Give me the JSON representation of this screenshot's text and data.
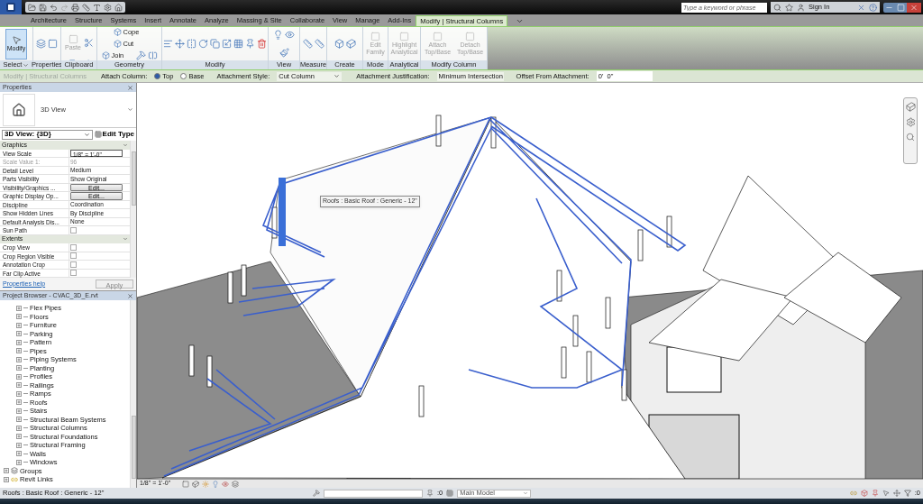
{
  "title_bar": {
    "search": {
      "placeholder": "Type a keyword or phrase"
    },
    "sign_in": "Sign In"
  },
  "ribbon_tabs": [
    {
      "label": "Architecture",
      "selected": false
    },
    {
      "label": "Structure",
      "selected": false
    },
    {
      "label": "Systems",
      "selected": false
    },
    {
      "label": "Insert",
      "selected": false
    },
    {
      "label": "Annotate",
      "selected": false
    },
    {
      "label": "Analyze",
      "selected": false
    },
    {
      "label": "Massing & Site",
      "selected": false
    },
    {
      "label": "Collaborate",
      "selected": false
    },
    {
      "label": "View",
      "selected": false
    },
    {
      "label": "Manage",
      "selected": false
    },
    {
      "label": "Add-Ins",
      "selected": false
    },
    {
      "label": "Modify | Structural Columns",
      "selected": true
    }
  ],
  "ribbon_panels": [
    {
      "title": "Select",
      "dropdown": true,
      "buttons": [
        {
          "label": "Modify",
          "kind": "large",
          "selected": true,
          "disabled": false
        }
      ]
    },
    {
      "title": "Properties"
    },
    {
      "title": "Clipboard",
      "buttons": [
        {
          "label": "Paste",
          "kind": "large",
          "selected": false,
          "disabled": true
        }
      ]
    },
    {
      "title": "Geometry",
      "buttons": [
        {
          "label": "Cope",
          "kind": "small",
          "selected": false,
          "disabled": false
        },
        {
          "label": "Cut",
          "kind": "small",
          "selected": false,
          "disabled": false
        },
        {
          "label": "Join",
          "kind": "small",
          "selected": false,
          "disabled": false
        }
      ]
    },
    {
      "title": "Modify"
    },
    {
      "title": "View"
    },
    {
      "title": "Measure"
    },
    {
      "title": "Create"
    },
    {
      "title": "Mode",
      "buttons": [
        {
          "label": "Edit Family",
          "kind": "large",
          "selected": false,
          "disabled": true
        }
      ]
    },
    {
      "title": "Analytical",
      "buttons": [
        {
          "label": "Highlight Analytical",
          "kind": "large",
          "selected": false,
          "disabled": true
        }
      ]
    },
    {
      "title": "Modify Column",
      "buttons": [
        {
          "label": "Attach Top/Base",
          "kind": "large",
          "selected": false,
          "disabled": true
        },
        {
          "label": "Detach Top/Base",
          "kind": "large",
          "selected": false,
          "disabled": true
        }
      ]
    }
  ],
  "options_bar": {
    "context": "Modify | Structural Columns",
    "attach_label": "Attach Column:",
    "attach_options": [
      {
        "label": "Top",
        "selected": true
      },
      {
        "label": "Base",
        "selected": false
      }
    ],
    "style_label": "Attachment Style:",
    "style_value": "Cut Column",
    "justification_label": "Attachment Justification:",
    "justification_value": "Minimum Intersection",
    "offset_label": "Offset From Attachment:",
    "offset_value": "0'  0\""
  },
  "properties": {
    "title": "Properties",
    "type_name": "3D View",
    "selector": "3D View: {3D}",
    "edit_type": "Edit Type",
    "groups": [
      {
        "name": "Graphics",
        "rows": [
          {
            "name": "View Scale",
            "kind": "input",
            "value": "1/8\" = 1'-0\"",
            "disabled": false
          },
          {
            "name": "Scale Value    1:",
            "kind": "text",
            "value": "96",
            "disabled": true
          },
          {
            "name": "Detail Level",
            "kind": "text",
            "value": "Medium",
            "disabled": false
          },
          {
            "name": "Parts Visibility",
            "kind": "text",
            "value": "Show Original",
            "disabled": false
          },
          {
            "name": "Visibility/Graphics ...",
            "kind": "button",
            "value": "Edit...",
            "disabled": false
          },
          {
            "name": "Graphic Display Op...",
            "kind": "button",
            "value": "Edit...",
            "disabled": false
          },
          {
            "name": "Discipline",
            "kind": "text",
            "value": "Coordination",
            "disabled": false
          },
          {
            "name": "Show Hidden Lines",
            "kind": "text",
            "value": "By Discipline",
            "disabled": false
          },
          {
            "name": "Default Analysis Dis...",
            "kind": "text",
            "value": "None",
            "disabled": false
          },
          {
            "name": "Sun Path",
            "kind": "checkbox",
            "checked": false,
            "disabled": false
          }
        ]
      },
      {
        "name": "Extents",
        "rows": [
          {
            "name": "Crop View",
            "kind": "checkbox",
            "checked": false,
            "disabled": false
          },
          {
            "name": "Crop Region Visible",
            "kind": "checkbox",
            "checked": false,
            "disabled": false
          },
          {
            "name": "Annotation Crop",
            "kind": "checkbox",
            "checked": false,
            "disabled": false
          },
          {
            "name": "Far Clip Active",
            "kind": "checkbox",
            "checked": false,
            "disabled": false
          }
        ]
      }
    ],
    "help": "Properties help",
    "apply": "Apply"
  },
  "project_browser": {
    "title": "Project Browser - CVAC_3D_E.rvt",
    "items": [
      {
        "children": [
          {
            "label": "Flex Pipes",
            "kind": "category"
          },
          {
            "label": "Floors",
            "kind": "category"
          },
          {
            "label": "Furniture",
            "kind": "category"
          },
          {
            "label": "Parking",
            "kind": "category"
          },
          {
            "label": "Pattern",
            "kind": "category"
          },
          {
            "label": "Pipes",
            "kind": "category"
          },
          {
            "label": "Piping Systems",
            "kind": "category"
          },
          {
            "label": "Planting",
            "kind": "category"
          },
          {
            "label": "Profiles",
            "kind": "category"
          },
          {
            "label": "Railings",
            "kind": "category"
          },
          {
            "label": "Ramps",
            "kind": "category"
          },
          {
            "label": "Roofs",
            "kind": "category"
          },
          {
            "label": "Stairs",
            "kind": "category"
          },
          {
            "label": "Structural Beam Systems",
            "kind": "category"
          },
          {
            "label": "Structural Columns",
            "kind": "category"
          },
          {
            "label": "Structural Foundations",
            "kind": "category"
          },
          {
            "label": "Structural Framing",
            "kind": "category"
          },
          {
            "label": "Walls",
            "kind": "category"
          },
          {
            "label": "Windows",
            "kind": "category"
          }
        ]
      },
      {
        "label": "Groups",
        "kind": "groups"
      },
      {
        "label": "Revit Links",
        "kind": "links"
      }
    ]
  },
  "viewport": {
    "tooltip": "Roofs : Basic Roof : Generic - 12\"",
    "scale": "1/8\" = 1'-0\""
  },
  "status_bar": {
    "message": "Roofs : Basic Roof : Generic - 12\"",
    "editable_count": ":0",
    "workset": "Main Model",
    "filter_count": ":0"
  }
}
